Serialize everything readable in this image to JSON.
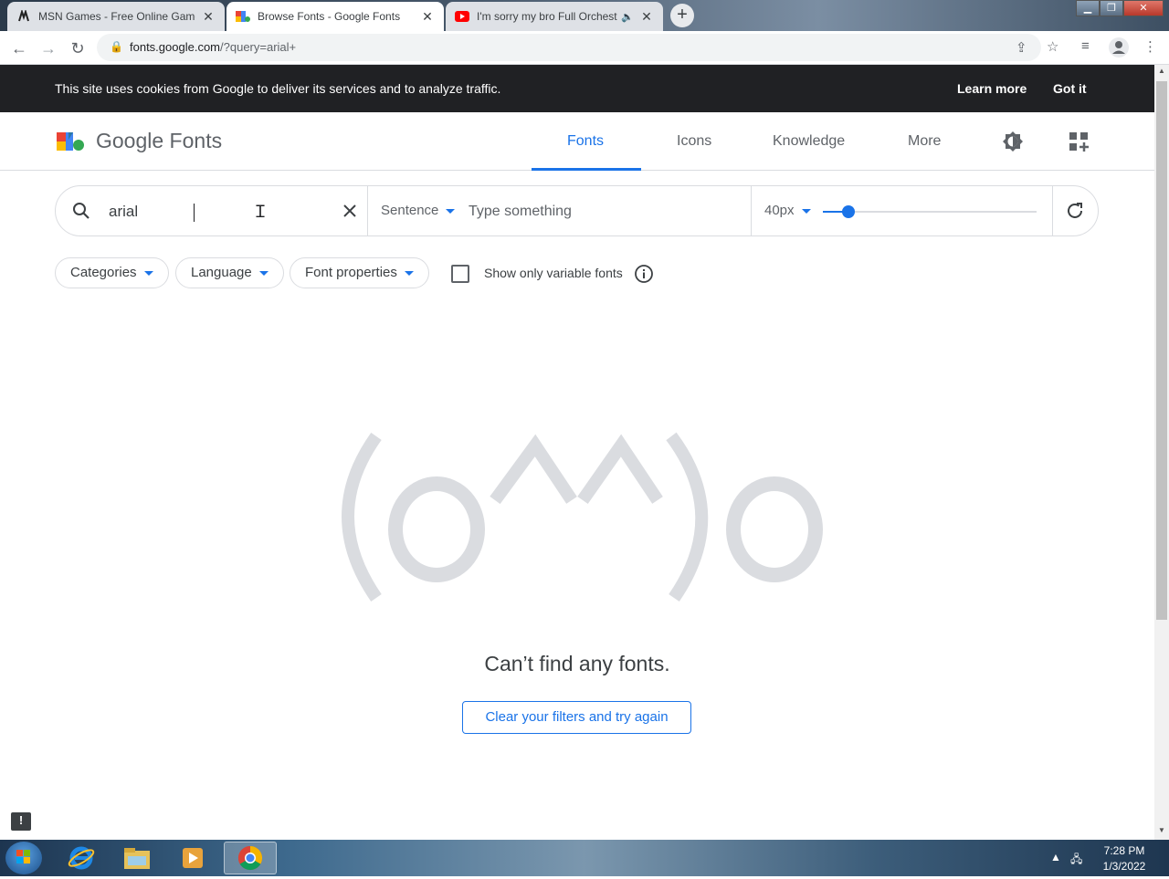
{
  "browser": {
    "tabs": [
      {
        "title": "MSN Games - Free Online Games",
        "favicon": "msn-icon",
        "active": false
      },
      {
        "title": "Browse Fonts - Google Fonts",
        "favicon": "google-fonts-icon",
        "active": true
      },
      {
        "title": "I'm sorry my bro Full Orchestra",
        "favicon": "youtube-icon",
        "active": false,
        "muted_icon": "speaker-icon"
      }
    ],
    "url_host": "fonts.google.com",
    "url_path": "/?query=arial+"
  },
  "cookie_banner": {
    "message": "This site uses cookies from Google to deliver its services and to analyze traffic.",
    "learn_more": "Learn more",
    "got_it": "Got it"
  },
  "header": {
    "logo_text": "Google Fonts",
    "nav": [
      "Fonts",
      "Icons",
      "Knowledge",
      "More"
    ],
    "active_nav": "Fonts"
  },
  "search": {
    "query": "arial",
    "preview_mode": "Sentence",
    "preview_placeholder": "Type something",
    "size_label": "40px",
    "size_slider_fraction": 0.12
  },
  "filters": {
    "categories": "Categories",
    "language": "Language",
    "font_properties": "Font properties",
    "variable_only_label": "Show only variable fonts",
    "variable_only_checked": false
  },
  "empty_state": {
    "emoticon": "(o^^)o",
    "title": "Can’t find any fonts.",
    "button": "Clear your filters and try again"
  },
  "taskbar": {
    "time": "7:28 PM",
    "date": "1/3/2022"
  },
  "colors": {
    "accent": "#1a73e8",
    "banner_bg": "#202124",
    "emoticon": "#dadce0"
  }
}
